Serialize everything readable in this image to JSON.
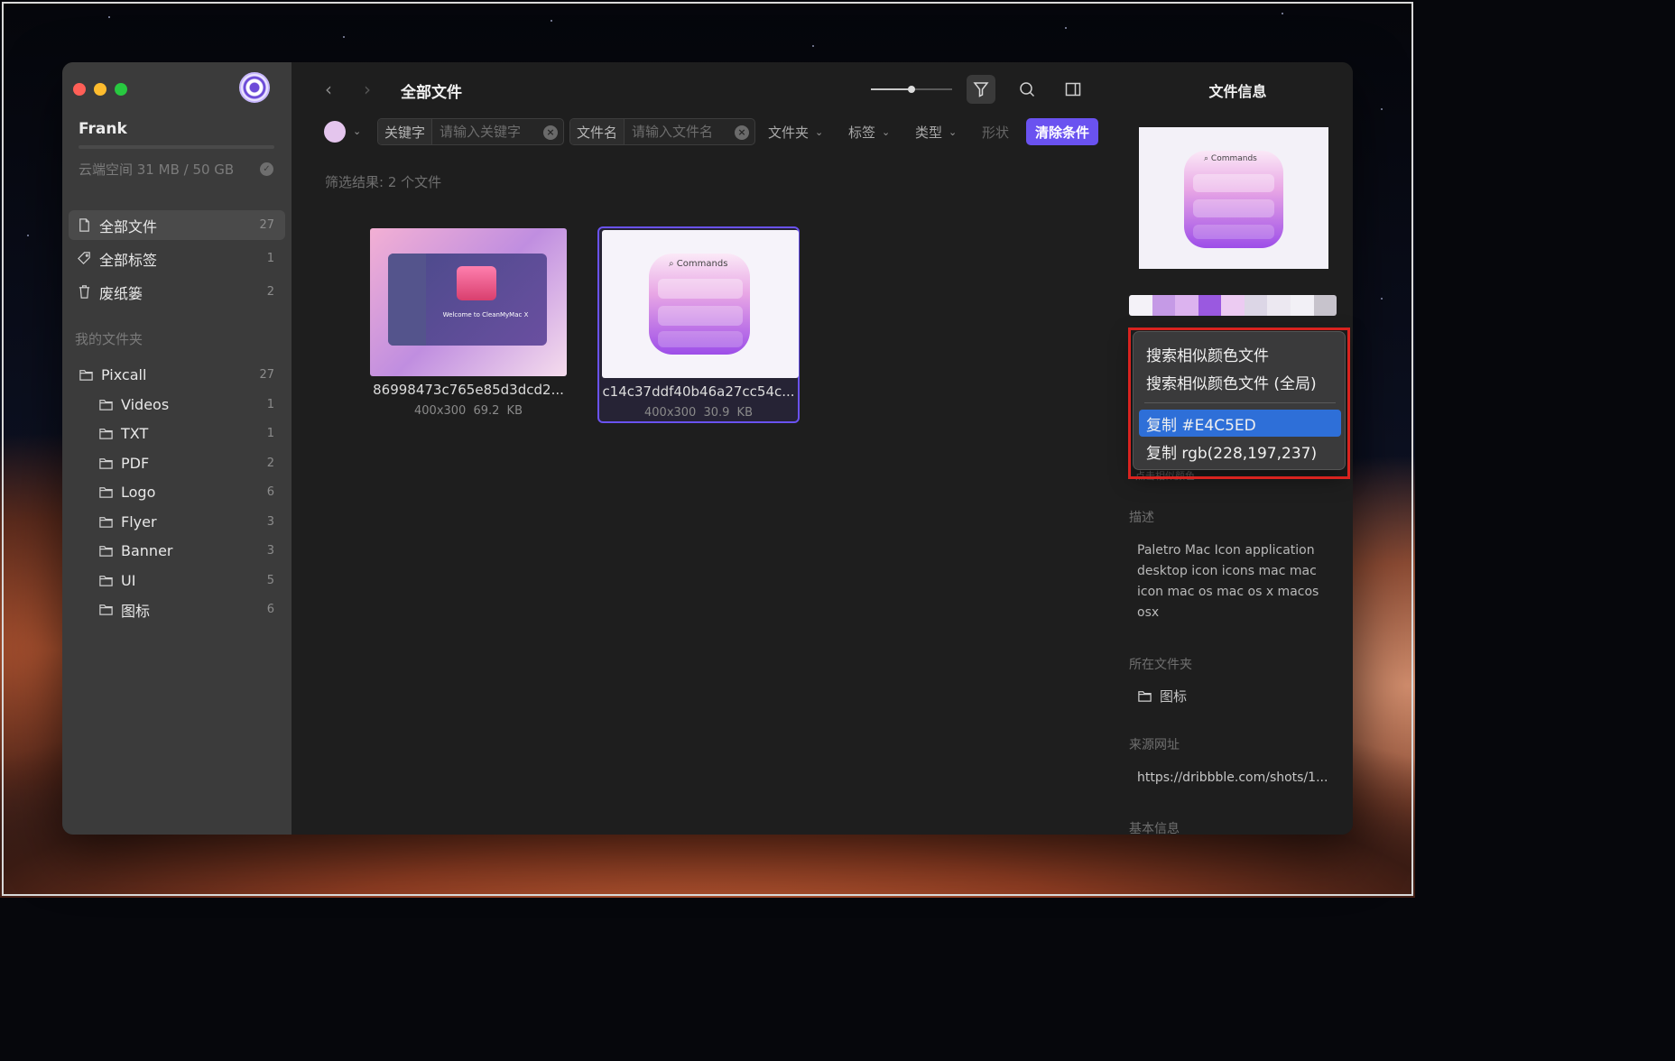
{
  "sidebar": {
    "username": "Frank",
    "quota": "云端空间 31 MB / 50 GB",
    "nav": [
      {
        "label": "全部文件",
        "count": "27"
      },
      {
        "label": "全部标签",
        "count": "1"
      },
      {
        "label": "废纸篓",
        "count": "2"
      }
    ],
    "section_title": "我的文件夹",
    "folders": [
      {
        "label": "Pixcall",
        "count": "27"
      },
      {
        "label": "Videos",
        "count": "1"
      },
      {
        "label": "TXT",
        "count": "1"
      },
      {
        "label": "PDF",
        "count": "2"
      },
      {
        "label": "Logo",
        "count": "6"
      },
      {
        "label": "Flyer",
        "count": "3"
      },
      {
        "label": "Banner",
        "count": "3"
      },
      {
        "label": "UI",
        "count": "5"
      },
      {
        "label": "图标",
        "count": "6"
      }
    ]
  },
  "main": {
    "title": "全部文件",
    "zoom_level": 0.5,
    "filter": {
      "color": "#E4C5ED",
      "keyword_label": "关键字",
      "keyword_placeholder": "请输入关键字",
      "filename_label": "文件名",
      "filename_placeholder": "请输入文件名",
      "folder_label": "文件夹",
      "tag_label": "标签",
      "type_label": "类型",
      "shape_label": "形状",
      "clear_label": "清除条件"
    },
    "result_text": "筛选结果: 2 个文件",
    "files": [
      {
        "name": "86998473c765e85d3dcd2...",
        "dims": "400x300",
        "size": "69.2 KB",
        "thumb_text": "Welcome to CleanMyMac X"
      },
      {
        "name": "c14c37ddf40b46a27cc54c...",
        "dims": "400x300",
        "size": "30.9 KB",
        "thumb_text": "Commands"
      }
    ]
  },
  "info": {
    "title": "文件信息",
    "preview_text": "Commands",
    "palette": [
      "#f4f2f8",
      "#c59ae6",
      "#dcb3ef",
      "#9a59e0",
      "#eccbf2",
      "#dcd6e6",
      "#ece8f1",
      "#f2f0f6",
      "#c7c3cc"
    ],
    "desc_label": "描述",
    "desc": "Paletro Mac Icon application desktop icon icons mac mac icon mac os mac os x macos osx",
    "folder_label": "所在文件夹",
    "folder_value": "图标",
    "source_label": "来源网址",
    "source_value": "https://dribbble.com/shots/1...",
    "basic_label": "基本信息"
  },
  "context_menu": {
    "items": [
      "搜索相似颜色文件",
      "搜索相似颜色文件 (全局)",
      "复制 #E4C5ED",
      "复制 rgb(228,197,237)"
    ],
    "peek": "点击相似颜色"
  }
}
